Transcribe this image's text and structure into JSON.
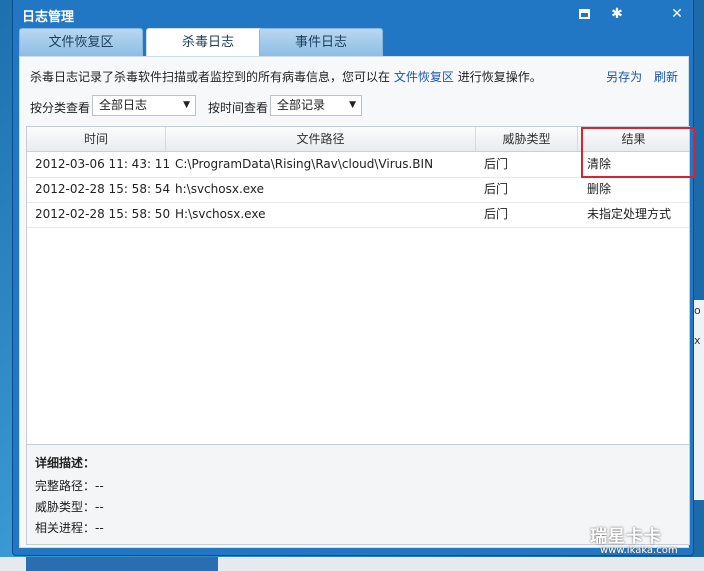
{
  "window": {
    "title": "日志管理"
  },
  "tabs": [
    {
      "label": "文件恢复区"
    },
    {
      "label": "杀毒日志",
      "active": true
    },
    {
      "label": "事件日志"
    }
  ],
  "info": {
    "text": "杀毒日志记录了杀毒软件扫描或者监控到的所有病毒信息，您可以在",
    "link": "文件恢复区",
    "suffix": "进行恢复操作。"
  },
  "actions": {
    "save_as": "另存为",
    "refresh": "刷新"
  },
  "filters": {
    "category_label": "按分类查看",
    "category_value": "全部日志",
    "time_label": "按时间查看",
    "time_value": "全部记录"
  },
  "table": {
    "columns": [
      "时间",
      "文件路径",
      "威胁类型",
      "结果"
    ],
    "rows": [
      {
        "time": "2012-03-06 11: 43: 11",
        "path": "C:\\ProgramData\\Rising\\Rav\\cloud\\Virus.BIN",
        "type": "后门",
        "result": "清除"
      },
      {
        "time": "2012-02-28 15: 58: 54",
        "path": "h:\\svchosx.exe",
        "type": "后门",
        "result": "删除"
      },
      {
        "time": "2012-02-28 15: 58: 50",
        "path": "H:\\svchosx.exe",
        "type": "后门",
        "result": "未指定处理方式"
      }
    ]
  },
  "detail": {
    "title": "详细描述：",
    "full_path": "完整路径：--",
    "threat_type": "威胁类型：--",
    "process": "相关进程：--"
  },
  "watermark": {
    "brand": "瑞星卡卡",
    "url": "www.ikaka.com"
  },
  "colors": {
    "highlight": "#d9232d",
    "link": "#1a57b0",
    "titlebar": "#2277c4"
  }
}
